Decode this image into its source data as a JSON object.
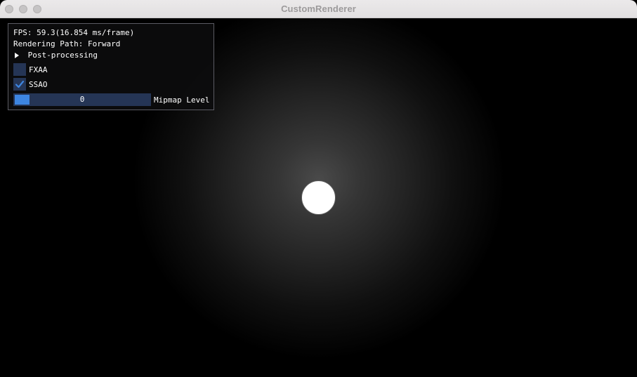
{
  "window": {
    "title": "CustomRenderer"
  },
  "overlay": {
    "fps_text": "FPS: 59.3(16.854 ms/frame)",
    "rendering_path_text": "Rendering Path: Forward",
    "tree_node_label": "Post-processing",
    "checkboxes": [
      {
        "label": "FXAA",
        "checked": false
      },
      {
        "label": "SSAO",
        "checked": true
      }
    ],
    "slider": {
      "label": "Mipmap Level",
      "value": "0"
    }
  },
  "colors": {
    "panel_bg": "#0c0c0e",
    "frame_bg": "#253555",
    "accent": "#3d85e0",
    "sphere": "#ffffff"
  }
}
